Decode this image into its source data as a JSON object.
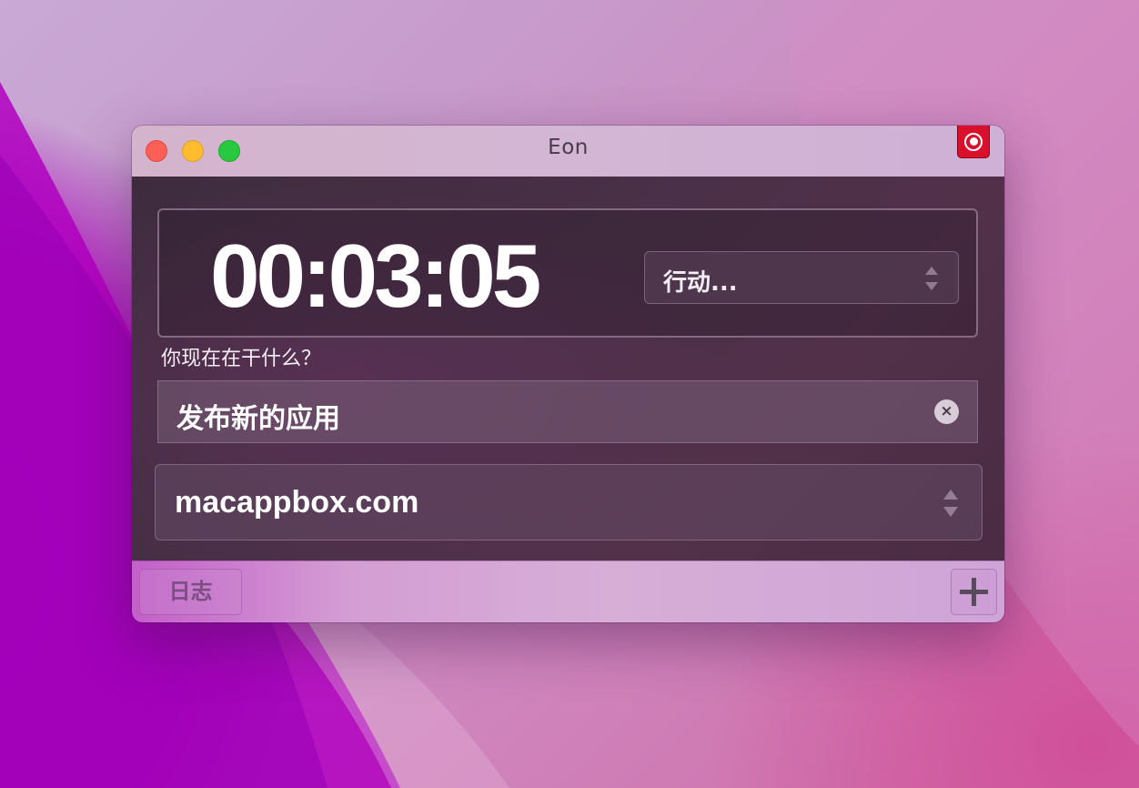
{
  "window": {
    "title": "Eon"
  },
  "timer": {
    "elapsed": "00:03:05"
  },
  "action_select": {
    "selected": "行动..."
  },
  "task": {
    "question": "你现在在干什么？",
    "value": "发布新的应用",
    "clear_icon": "×"
  },
  "project_select": {
    "selected": "macappbox.com"
  },
  "footer": {
    "log_label": "日志"
  },
  "icons": {
    "record": "record-icon",
    "clear": "clear-circle-icon",
    "add": "plus-icon",
    "stepper": "up-down-chevron-icon"
  },
  "colors": {
    "record_red": "#d8102c",
    "close": "#fe5f57",
    "minimize": "#febc2e",
    "zoom": "#28c840"
  }
}
